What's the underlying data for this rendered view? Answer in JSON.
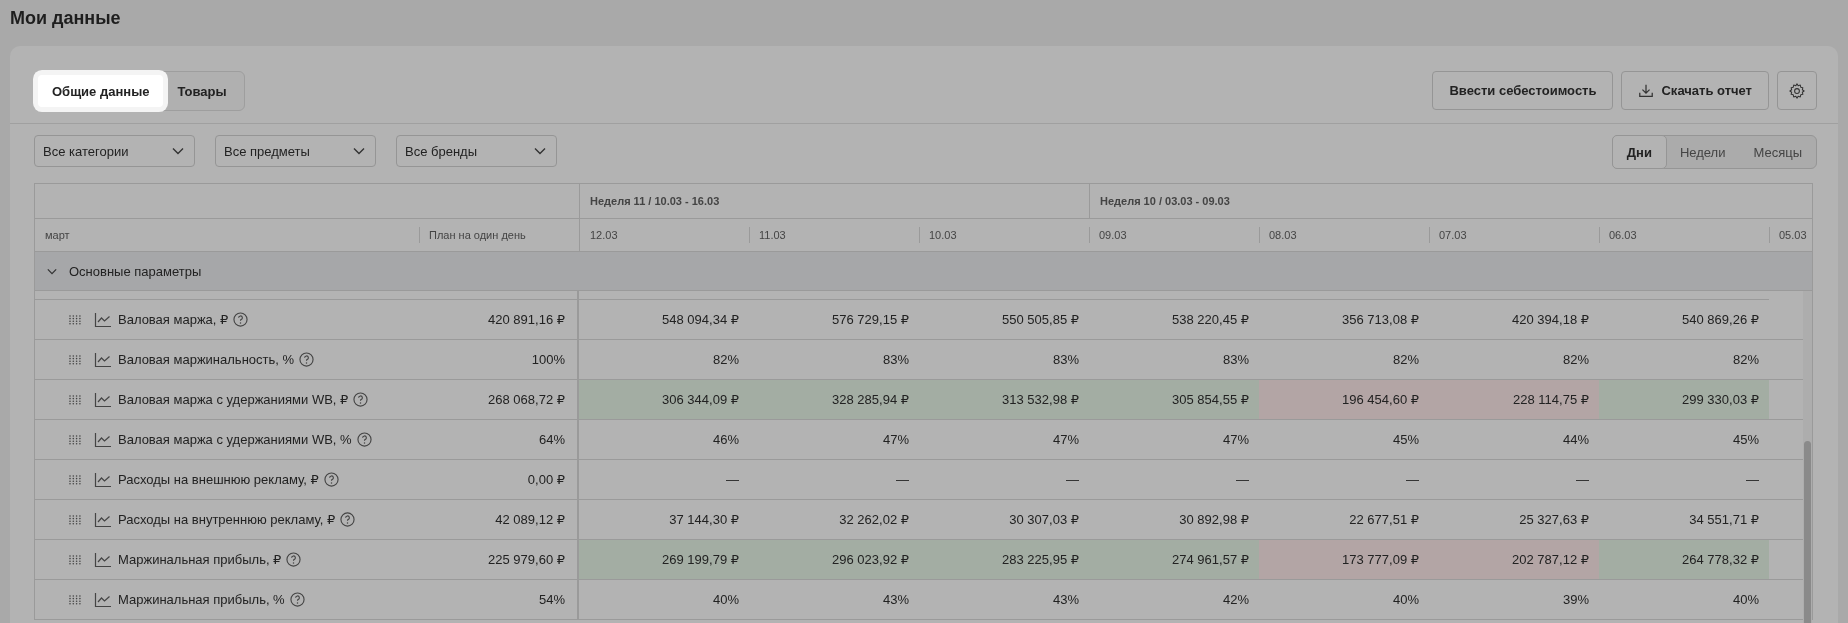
{
  "page": {
    "title": "Мои данные"
  },
  "tabs": [
    {
      "label": "Общие данные",
      "selected": true
    },
    {
      "label": "Товары",
      "selected": false
    }
  ],
  "actions": [
    {
      "kind": "text",
      "label": "Ввести себестоимость"
    },
    {
      "kind": "download",
      "label": "Скачать отчет"
    },
    {
      "kind": "settings"
    }
  ],
  "filters": [
    {
      "value": "Все категории"
    },
    {
      "value": "Все предметы"
    },
    {
      "value": "Все бренды"
    }
  ],
  "period": [
    {
      "label": "Дни",
      "selected": true
    },
    {
      "label": "Недели",
      "selected": false
    },
    {
      "label": "Месяцы",
      "selected": false
    }
  ],
  "table": {
    "month": "март",
    "plan_header": "План на один день",
    "weeks": [
      {
        "label": "Неделя 11 / 10.03 - 16.03",
        "dates": [
          "12.03",
          "11.03",
          "10.03"
        ]
      },
      {
        "label": "Неделя 10 / 03.03 - 09.03",
        "dates": [
          "09.03",
          "08.03",
          "07.03",
          "06.03",
          "05.03"
        ]
      }
    ],
    "group": {
      "label": "Основные параметры",
      "expanded": true
    },
    "rows": [
      {
        "label": "Валовая маржа, ₽",
        "plan": "420 891,16 ₽",
        "values": [
          "548 094,34 ₽",
          "576 729,15 ₽",
          "550 505,85 ₽",
          "538 220,45 ₽",
          "356 713,08 ₽",
          "420 394,18 ₽",
          "540 869,26 ₽"
        ]
      },
      {
        "label": "Валовая маржинальность, %",
        "plan": "100%",
        "values": [
          "82%",
          "83%",
          "83%",
          "83%",
          "82%",
          "82%",
          "82%"
        ]
      },
      {
        "label": "Валовая маржа с удержаниями WB, ₽",
        "plan": "268 068,72 ₽",
        "values": [
          "306 344,09 ₽",
          "328 285,94 ₽",
          "313 532,98 ₽",
          "305 854,55 ₽",
          "196 454,60 ₽",
          "228 114,75 ₽",
          "299 330,03 ₽"
        ],
        "over_plan": [
          true,
          true,
          true,
          true,
          false,
          false,
          true
        ]
      },
      {
        "label": "Валовая маржа с удержаниями WB, %",
        "plan": "64%",
        "values": [
          "46%",
          "47%",
          "47%",
          "47%",
          "45%",
          "44%",
          "45%"
        ]
      },
      {
        "label": "Расходы на внешнюю рекламу, ₽",
        "plan": "0,00 ₽",
        "values": [
          "—",
          "—",
          "—",
          "—",
          "—",
          "—",
          "—"
        ]
      },
      {
        "label": "Расходы на внутреннюю рекламу, ₽",
        "plan": "42 089,12 ₽",
        "values": [
          "37 144,30 ₽",
          "32 262,02 ₽",
          "30 307,03 ₽",
          "30 892,98 ₽",
          "22 677,51 ₽",
          "25 327,63 ₽",
          "34 551,71 ₽"
        ]
      },
      {
        "label": "Маржинальная прибыль, ₽",
        "plan": "225 979,60 ₽",
        "values": [
          "269 199,79 ₽",
          "296 023,92 ₽",
          "283 225,95 ₽",
          "274 961,57 ₽",
          "173 777,09 ₽",
          "202 787,12 ₽",
          "264 778,32 ₽"
        ],
        "over_plan": [
          true,
          true,
          true,
          true,
          false,
          false,
          true
        ]
      },
      {
        "label": "Маржинальная прибыль, %",
        "plan": "54%",
        "values": [
          "40%",
          "43%",
          "43%",
          "42%",
          "40%",
          "39%",
          "40%"
        ]
      }
    ]
  }
}
